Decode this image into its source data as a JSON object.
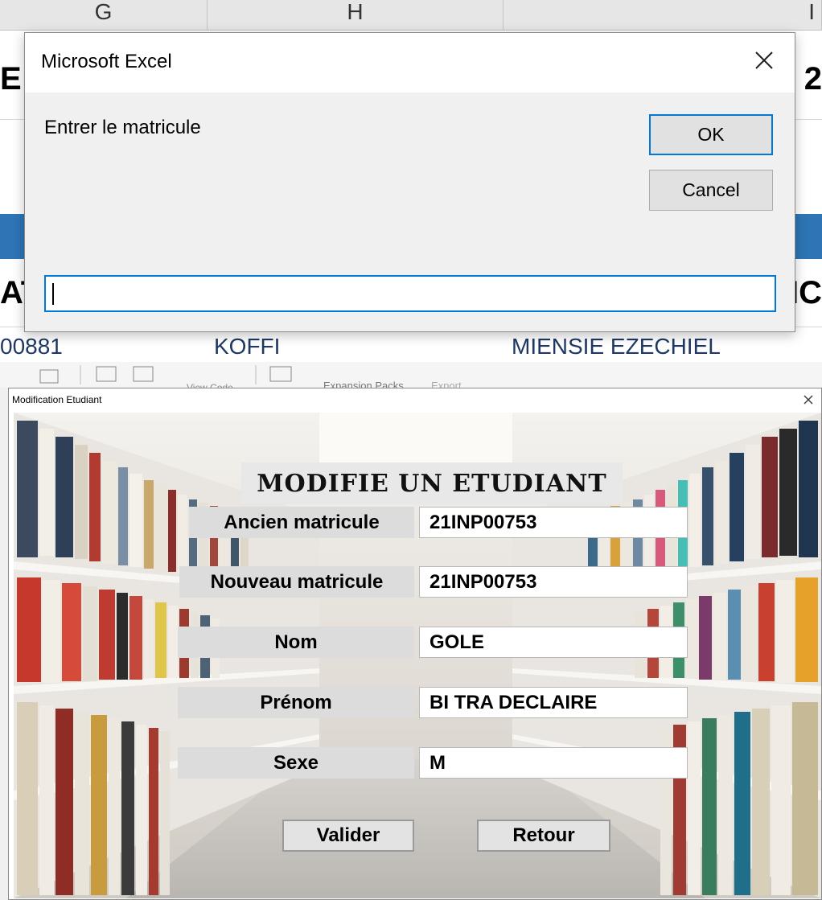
{
  "sheet": {
    "columns": [
      "G",
      "H",
      "I"
    ],
    "row_left_fragment": "E",
    "row_right_fragment": "2",
    "header_left_fragment": "AT",
    "header_right_fragment": "NC",
    "data_row": {
      "matricule_fragment": "00881",
      "nom": "KOFFI",
      "prenom": "MIENSIE EZECHIEL"
    },
    "colors": {
      "blue_band": "#2e75b6",
      "data_text": "#1f3864"
    }
  },
  "input_box": {
    "title": "Microsoft Excel",
    "prompt": "Entrer le matricule",
    "ok_label": "OK",
    "cancel_label": "Cancel",
    "value": "",
    "close_icon": "close-icon"
  },
  "vbe_toolbar": {
    "items": [
      "View Code",
      "Expansion Packs",
      "Export"
    ]
  },
  "form": {
    "window_title": "Modification Etudiant",
    "heading": "MODIFIE UN ETUDIANT",
    "fields": [
      {
        "label": "Ancien matricule",
        "value": "21INP00753"
      },
      {
        "label": "Nouveau matricule",
        "value": "21INP00753"
      },
      {
        "label": "Nom",
        "value": "GOLE"
      },
      {
        "label": "Prénom",
        "value": "BI TRA DECLAIRE"
      },
      {
        "label": "Sexe",
        "value": "M"
      }
    ],
    "buttons": {
      "validate_label": "Valider",
      "back_label": "Retour"
    },
    "background": "library-bookshelves-image"
  }
}
